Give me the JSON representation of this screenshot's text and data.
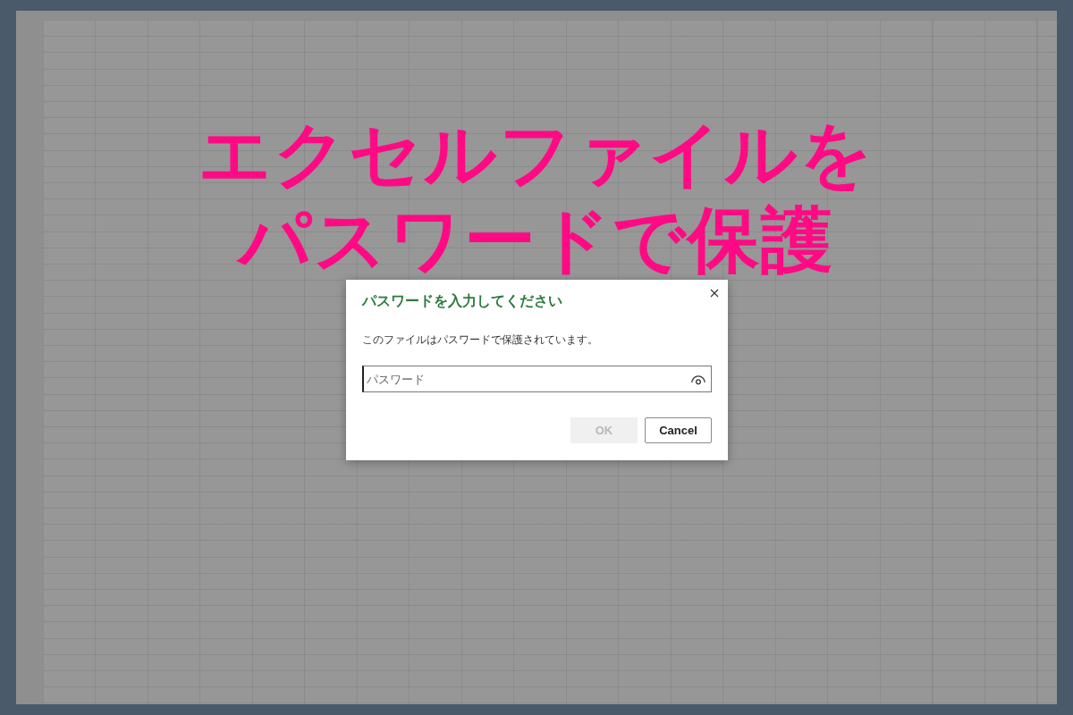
{
  "headline": {
    "lines": [
      "エクセルファイルを",
      "パスワードで保護"
    ]
  },
  "dialog": {
    "title": "パスワードを入力してください",
    "message": "このファイルはパスワードで保護されています。",
    "password_field": {
      "placeholder": "パスワード"
    },
    "buttons": [
      {
        "kind": "primary",
        "label": "OK",
        "disabled": true
      },
      {
        "kind": "secondary",
        "label": "Cancel",
        "disabled": false
      }
    ]
  }
}
